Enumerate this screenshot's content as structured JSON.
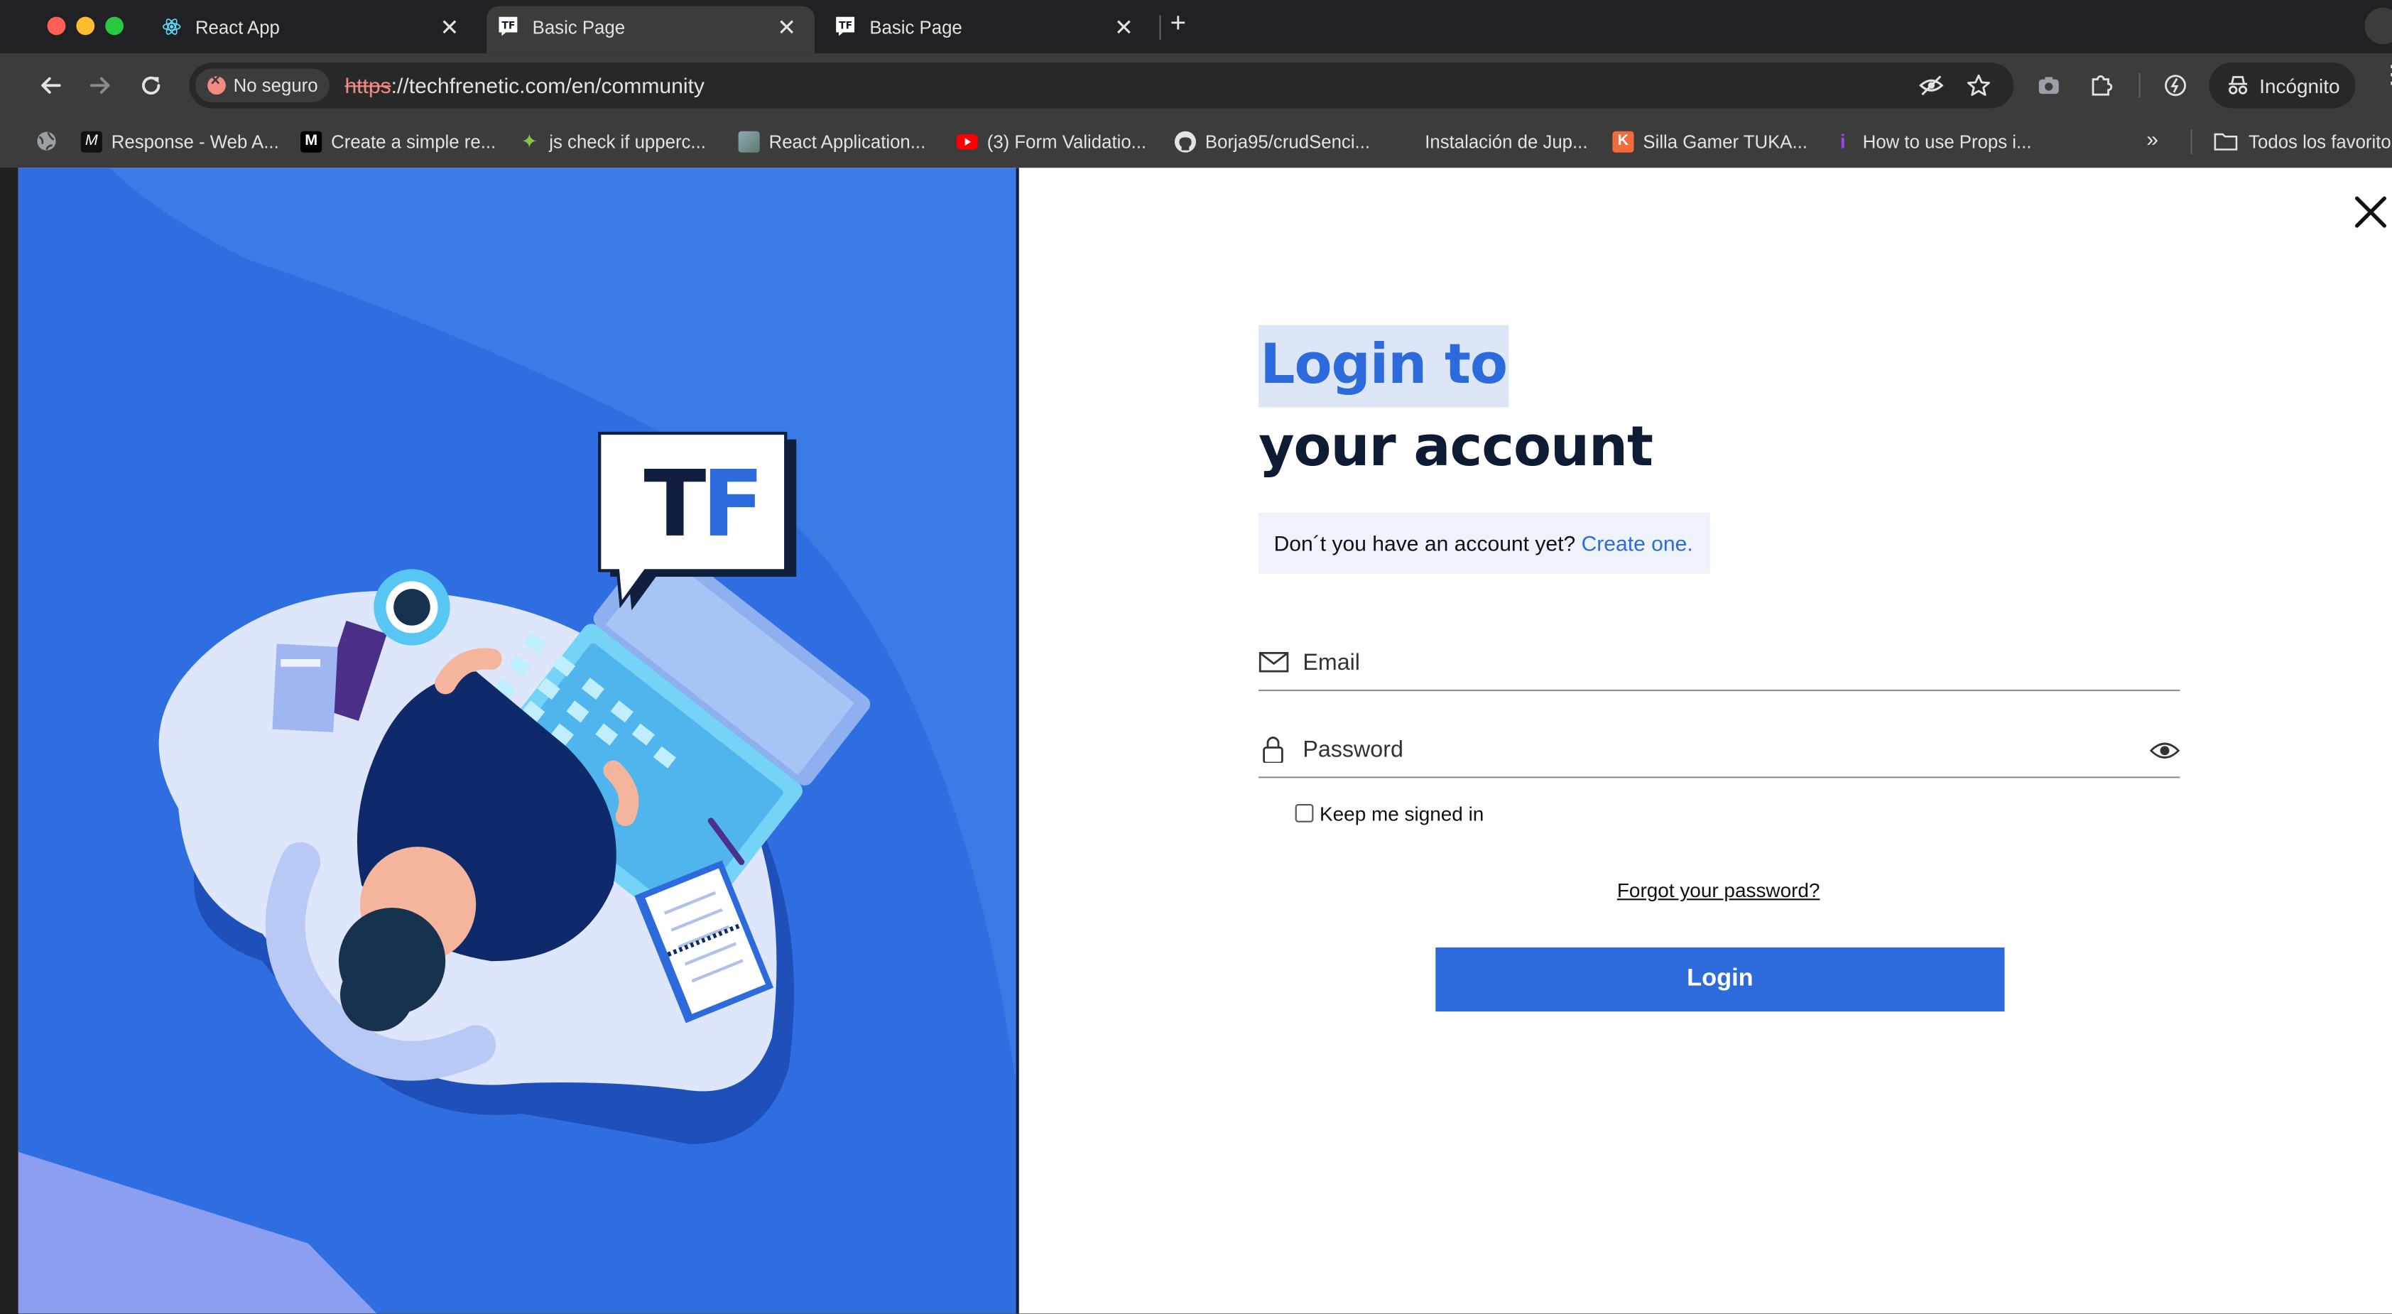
{
  "browser": {
    "tabs": [
      {
        "title": "React App",
        "icon": "react-icon",
        "active": false
      },
      {
        "title": "Basic Page",
        "icon": "techfrenetic-icon",
        "active": true
      },
      {
        "title": "Basic Page",
        "icon": "techfrenetic-icon",
        "active": false
      }
    ],
    "security_chip": "No seguro",
    "url_protocol": "https",
    "url_rest": "://techfrenetic.com/en/community",
    "incognito_label": "Incógnito",
    "bookmarks": [
      {
        "label": "Response - Web A...",
        "icon": "m-icon"
      },
      {
        "label": "Create a simple re...",
        "icon": "medium-icon"
      },
      {
        "label": "js check if upperc...",
        "icon": "sparkle-icon"
      },
      {
        "label": "React Application...",
        "icon": "image-icon"
      },
      {
        "label": "(3) Form Validatio...",
        "icon": "youtube-icon"
      },
      {
        "label": "Borja95/crudSenci...",
        "icon": "github-icon"
      },
      {
        "label": "Instalación de Jup...",
        "icon": "blank-icon"
      },
      {
        "label": "Silla Gamer TUKA...",
        "icon": "k-icon"
      },
      {
        "label": "How to use Props i...",
        "icon": "info-icon"
      }
    ],
    "bookmarks_folder": "Todos los favoritos"
  },
  "illustration": {
    "logo_text": "TF"
  },
  "login": {
    "heading_line1": "Login to",
    "heading_line2": "your account",
    "signup_question": "Don´t you have an account yet?",
    "signup_link": "Create one.",
    "email_placeholder": "Email",
    "password_placeholder": "Password",
    "keep_signed_in": "Keep me signed in",
    "forgot_password": "Forgot your password?",
    "login_button": "Login"
  },
  "colors": {
    "brand_blue": "#2d6bdc",
    "dark_navy": "#0d1b33",
    "chrome_dark": "#202124",
    "chrome_toolbar": "#3c3c3c"
  }
}
